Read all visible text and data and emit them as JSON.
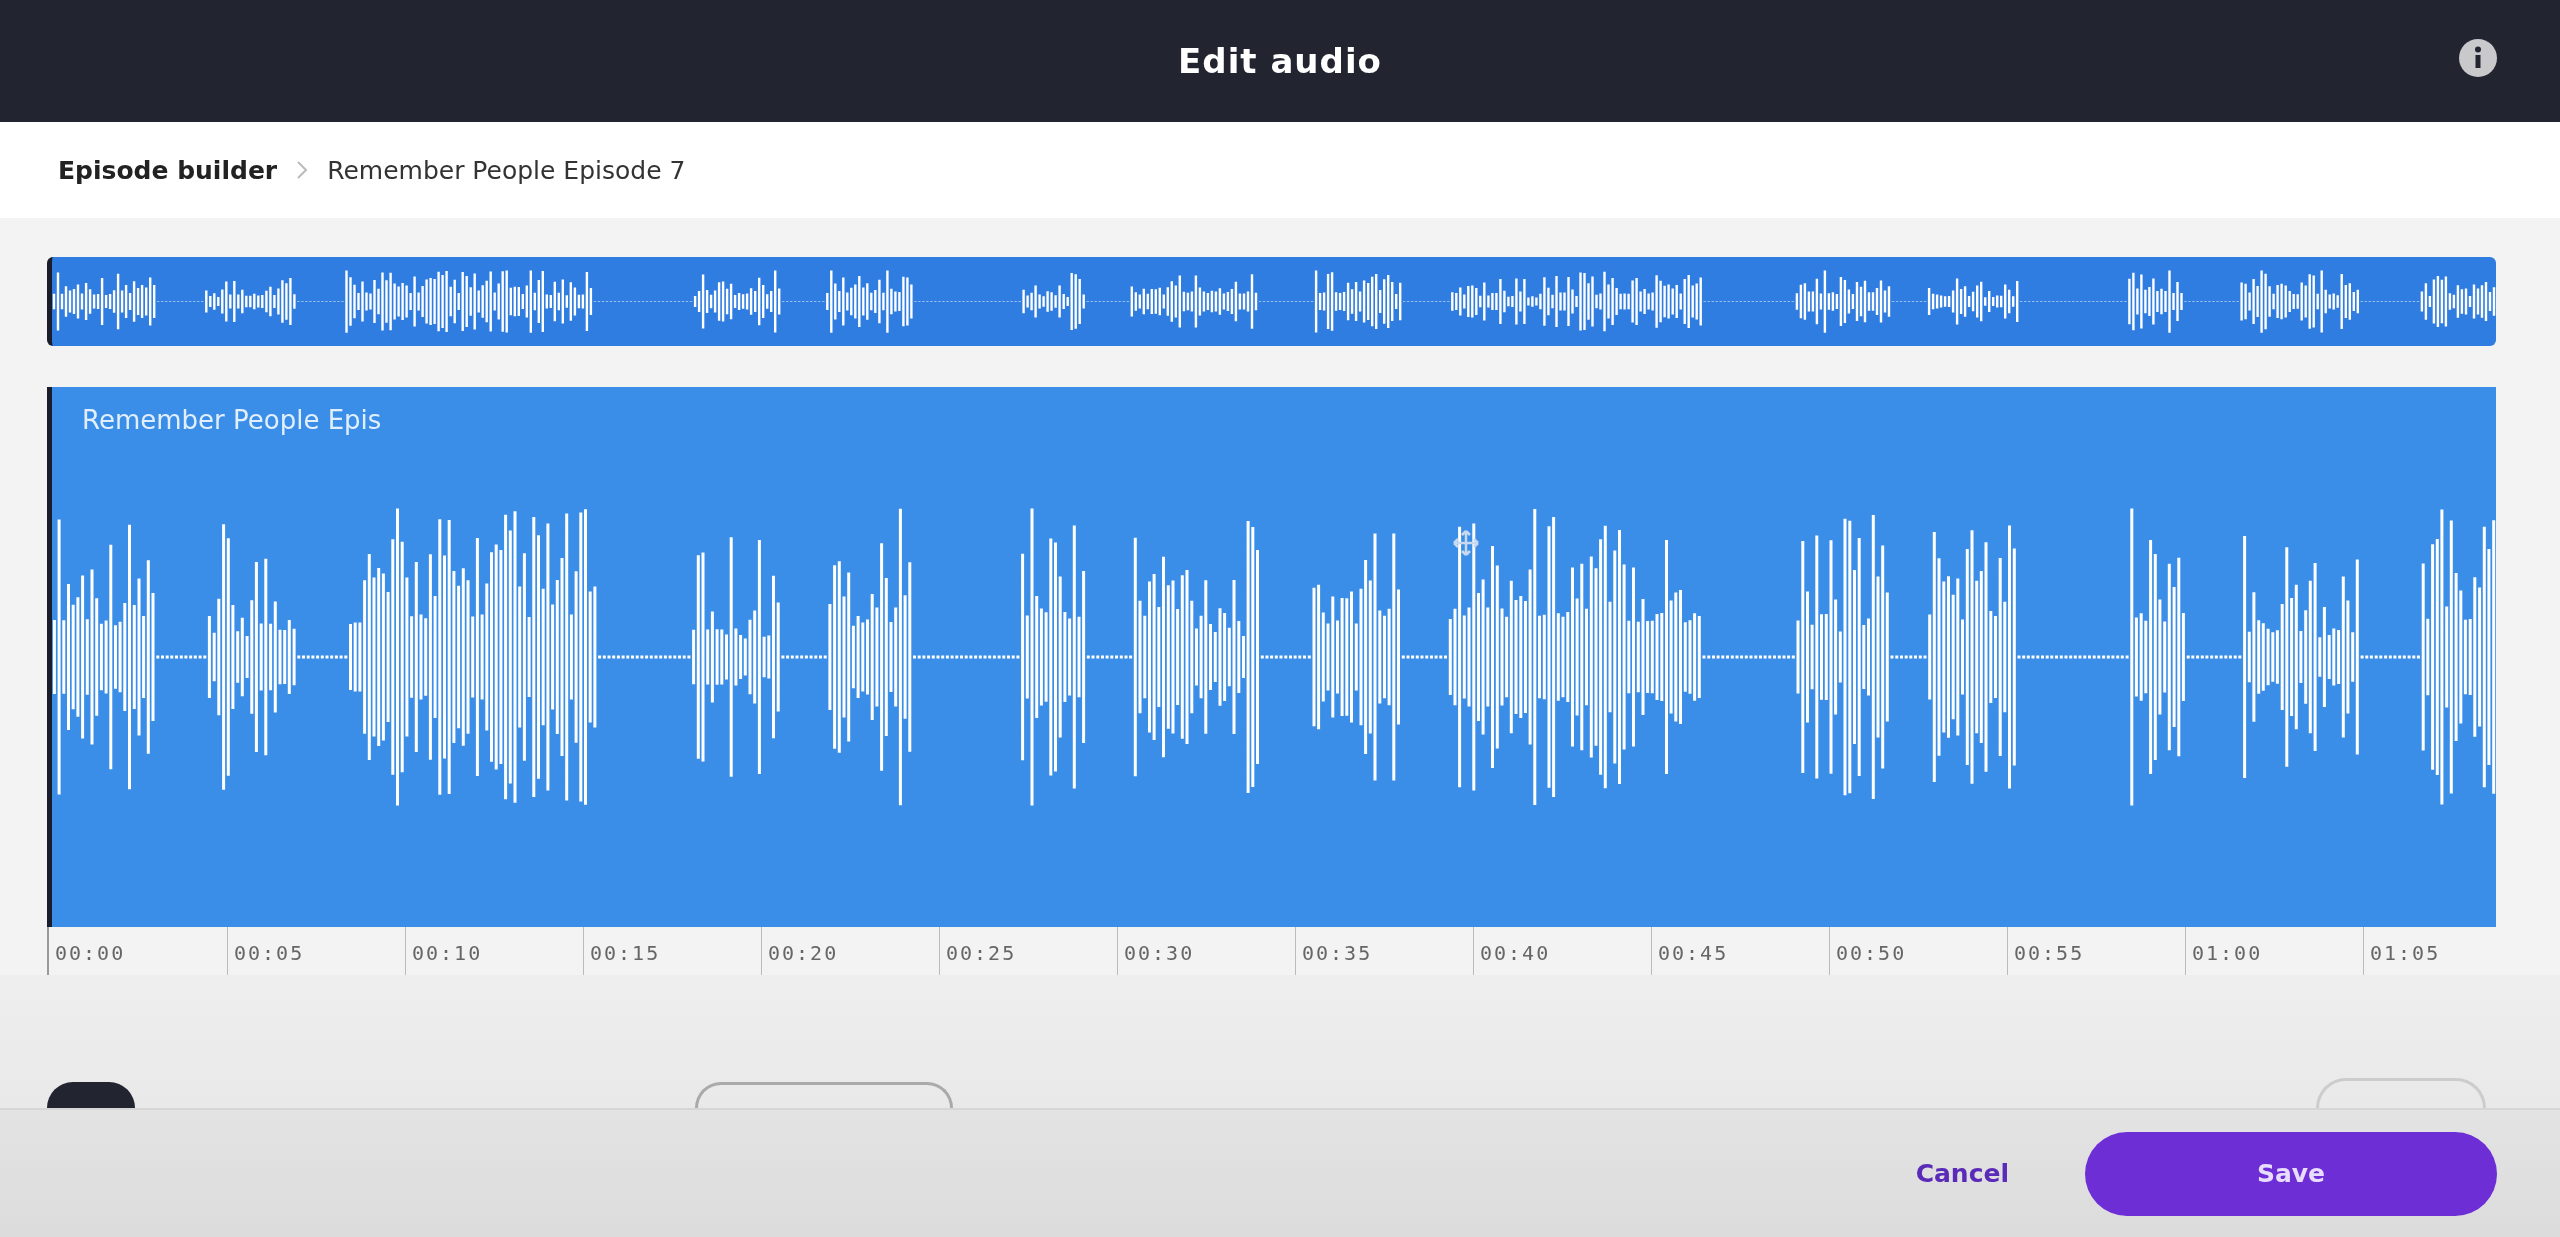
{
  "header": {
    "title": "Edit audio"
  },
  "breadcrumb": [
    {
      "label": "Episode builder",
      "selected": false
    },
    {
      "label": "Remember People Episode 7",
      "selected": true
    }
  ],
  "track": {
    "clip_label": "Remember People Epis"
  },
  "timeline": {
    "ticks": [
      "00:00",
      "00:05",
      "00:10",
      "00:15",
      "00:20",
      "00:25",
      "00:30",
      "00:35",
      "00:40",
      "00:45",
      "00:50",
      "00:55",
      "01:00",
      "01:05"
    ]
  },
  "footer": {
    "buttons": [
      {
        "label": "Cancel",
        "kind": "text"
      },
      {
        "label": "Save",
        "kind": "primary"
      }
    ]
  }
}
